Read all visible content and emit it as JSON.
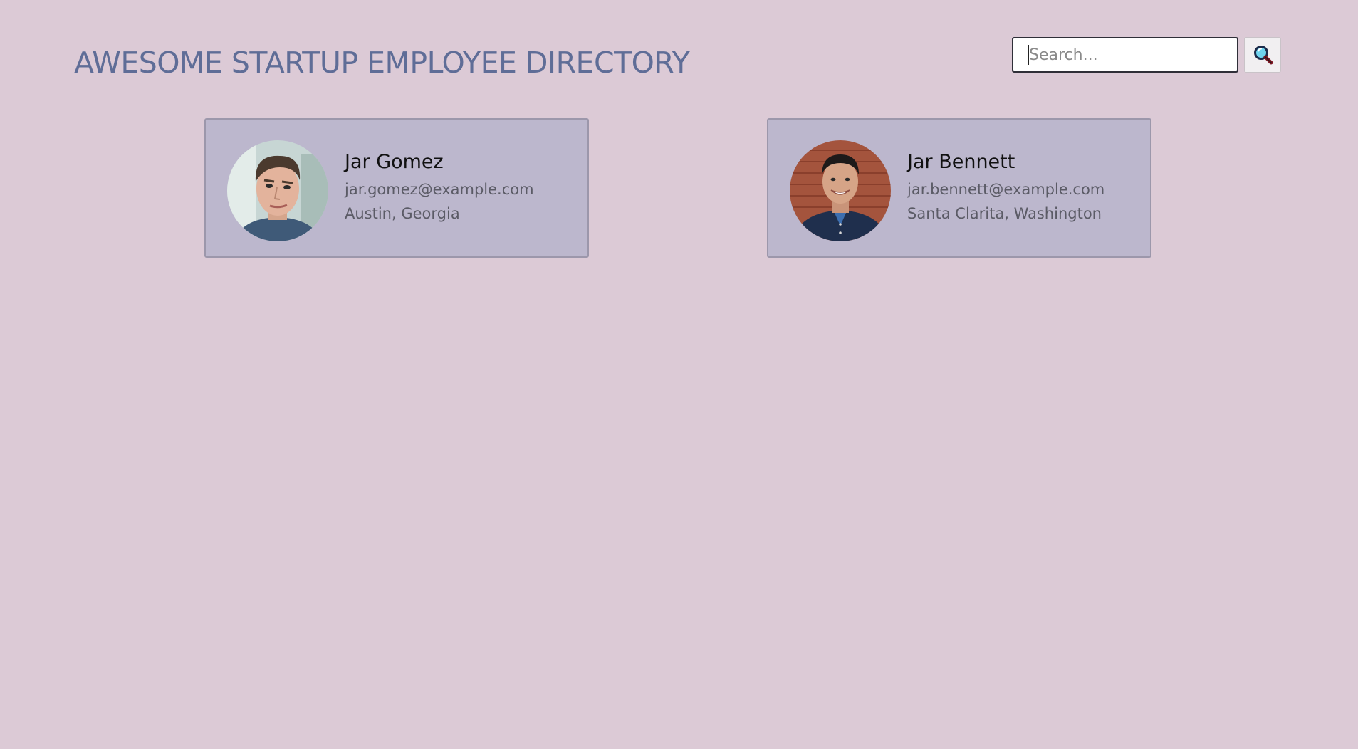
{
  "header": {
    "title": "AWESOME STARTUP EMPLOYEE DIRECTORY"
  },
  "search": {
    "placeholder": "Search...",
    "value": "",
    "button_icon": "search-icon"
  },
  "employees": [
    {
      "name": "Jar Gomez",
      "email": "jar.gomez@example.com",
      "location": "Austin, Georgia"
    },
    {
      "name": "Jar Bennett",
      "email": "jar.bennett@example.com",
      "location": "Santa Clarita, Washington"
    }
  ],
  "colors": {
    "background": "#dccad6",
    "title": "#5f6d97",
    "card_background": "#bcb7cd",
    "card_border": "#9c97ab"
  }
}
